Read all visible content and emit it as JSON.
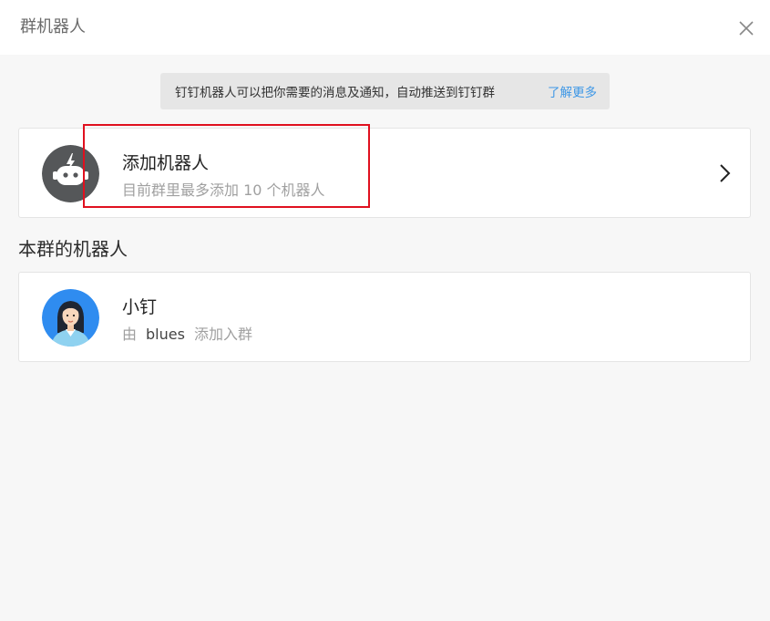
{
  "header": {
    "title": "群机器人"
  },
  "notice": {
    "text": "钉钉机器人可以把你需要的消息及通知，自动推送到钉钉群",
    "link": "了解更多"
  },
  "add_robot": {
    "title": "添加机器人",
    "subtitle": "目前群里最多添加 10 个机器人"
  },
  "section": {
    "title": "本群的机器人"
  },
  "robots": [
    {
      "name": "小钉",
      "prefix": "由",
      "added_by": "blues",
      "suffix": "添加入群"
    }
  ],
  "colors": {
    "link": "#3d97e6",
    "highlight": "#e0101f",
    "robot_icon_bg": "#555759",
    "avatar_bg": "#2f8cf0"
  }
}
